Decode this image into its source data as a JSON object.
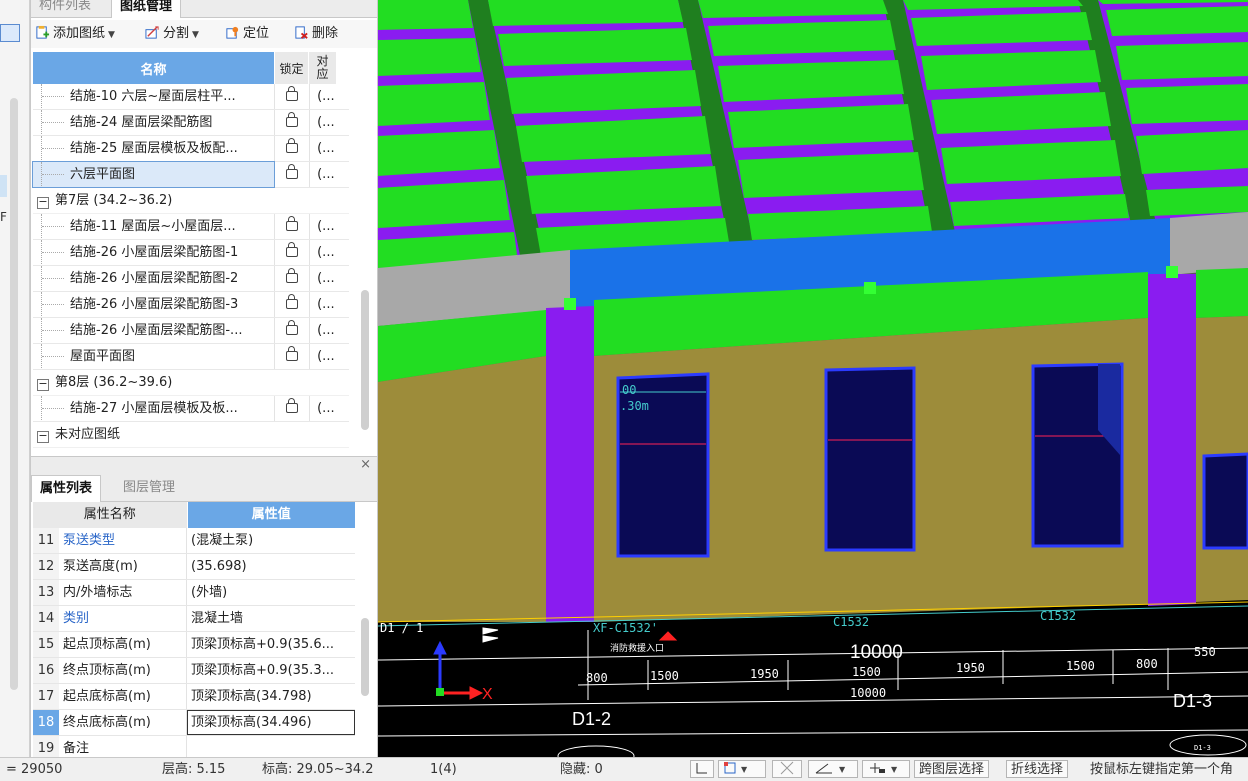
{
  "drawings_panel": {
    "tabs": [
      "构件列表",
      "图纸管理"
    ],
    "toolbar": {
      "add_drawing": "添加图纸",
      "split": "分割",
      "locate": "定位",
      "delete": "删除"
    },
    "table_headers": {
      "name": "名称",
      "lock": "锁定",
      "match": "对应"
    },
    "rows": [
      {
        "kind": "item",
        "name": "结施-10 六层~屋面层柱平...",
        "match": "(..."
      },
      {
        "kind": "item",
        "name": "结施-24 屋面层梁配筋图",
        "match": "(..."
      },
      {
        "kind": "item",
        "name": "结施-25 屋面层模板及板配...",
        "match": "(..."
      },
      {
        "kind": "item-selected",
        "name": "六层平面图",
        "match": "(..."
      },
      {
        "kind": "group",
        "name": "第7层 (34.2~36.2)"
      },
      {
        "kind": "item",
        "name": "结施-11 屋面层~小屋面层...",
        "match": "(..."
      },
      {
        "kind": "item",
        "name": "结施-26 小屋面层梁配筋图-1",
        "match": "(..."
      },
      {
        "kind": "item",
        "name": "结施-26 小屋面层梁配筋图-2",
        "match": "(..."
      },
      {
        "kind": "item",
        "name": "结施-26 小屋面层梁配筋图-3",
        "match": "(..."
      },
      {
        "kind": "item",
        "name": "结施-26 小屋面层梁配筋图-...",
        "match": "(..."
      },
      {
        "kind": "item-short",
        "name": "屋面平面图",
        "match": "(..."
      },
      {
        "kind": "group",
        "name": "第8层 (36.2~39.6)"
      },
      {
        "kind": "item",
        "name": "结施-27 小屋面层模板及板...",
        "match": "(..."
      },
      {
        "kind": "group-top",
        "name": "未对应图纸"
      }
    ]
  },
  "properties_panel": {
    "tabs": [
      "属性列表",
      "图层管理"
    ],
    "close": "×",
    "headers": {
      "name": "属性名称",
      "value": "属性值"
    },
    "rows": [
      {
        "index": "11",
        "name": "泵送类型",
        "value": "(混凝土泵)",
        "blue": true
      },
      {
        "index": "12",
        "name": "泵送高度(m)",
        "value": "(35.698)",
        "blue": false
      },
      {
        "index": "13",
        "name": "内/外墙标志",
        "value": "(外墙)",
        "blue": false
      },
      {
        "index": "14",
        "name": "类别",
        "value": "混凝土墙",
        "blue": true
      },
      {
        "index": "15",
        "name": "起点顶标高(m)",
        "value": "顶梁顶标高+0.9(35.6...",
        "blue": false
      },
      {
        "index": "16",
        "name": "终点顶标高(m)",
        "value": "顶梁顶标高+0.9(35.3...",
        "blue": false
      },
      {
        "index": "17",
        "name": "起点底标高(m)",
        "value": "顶梁顶标高(34.798)",
        "blue": false
      },
      {
        "index": "18",
        "name": "终点底标高(m)",
        "value": "顶梁顶标高(34.496)",
        "blue": false,
        "selected": true
      },
      {
        "index": "19",
        "name": "备注",
        "value": "",
        "blue": false
      }
    ]
  },
  "left_strip": {
    "label": "F"
  },
  "viewport": {
    "cad_texts": {
      "xf_label": "XF-C1532'",
      "c1532_a": "C1532",
      "c1532_b": "C1532",
      "fire_entrance": "消防救援入口",
      "dim_10000_big": "10000",
      "dim_10000_small": "10000",
      "dims": [
        "800",
        "1500",
        "1950",
        "1500",
        "1950",
        "1500",
        "800",
        "550"
      ],
      "axis_d1_2": "D1-2",
      "axis_d1_3": "D1-3",
      "axis_d1_3_small": "D1-3",
      "window_text_1": "00",
      "window_text_2": ".30m",
      "d1_label": "D1 / 1"
    },
    "axis_x": "X",
    "colors": {
      "slab": "#22dd22",
      "beam": "#1f7f1f",
      "column": "#8a1cf0",
      "wall": "#9d8c3a",
      "top_beam": "#1a72e8",
      "window": "#0a0a55"
    }
  },
  "status_bar": {
    "coord": "= 29050",
    "floor_height": "层高: 5.15",
    "elevation": "标高: 29.05~34.2",
    "count": "1(4)",
    "hidden": "隐藏: 0",
    "cross_layer_select": "跨图层选择",
    "polyline_select": "折线选择",
    "hint": "按鼠标左键指定第一个角"
  }
}
